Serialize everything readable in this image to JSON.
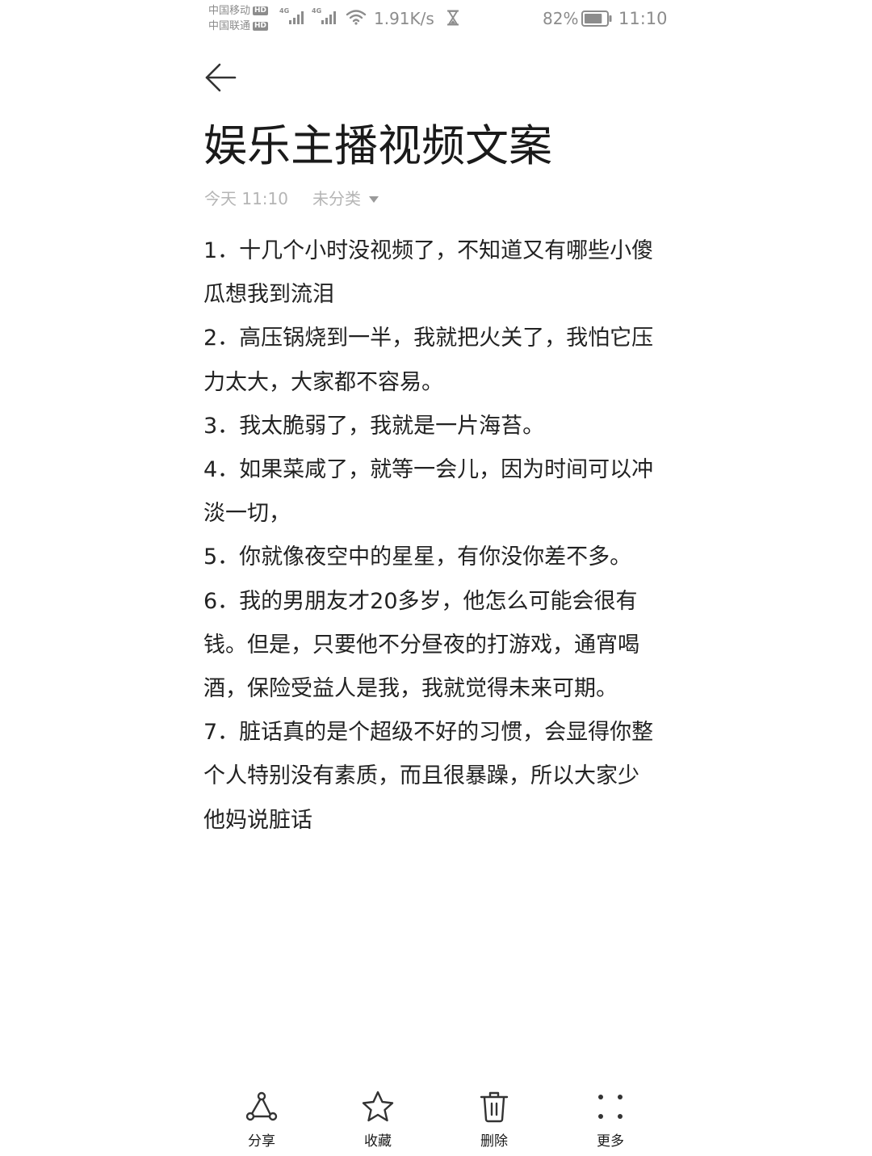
{
  "status_bar": {
    "carrier1": "中国移动",
    "carrier2": "中国联通",
    "hd_badge": "HD",
    "network1": "4G",
    "network2": "4G",
    "net_speed": "1.91K/s",
    "battery": "82%",
    "battery_level": 0.82,
    "time": "11:10"
  },
  "note": {
    "title": "娱乐主播视频文案",
    "date": "今天 11:10",
    "category": "未分类",
    "items": [
      "1．十几个小时没视频了，不知道又有哪些小傻瓜想我到流泪",
      "2．高压锅烧到一半，我就把火关了，我怕它压力太大，大家都不容易。",
      "3．我太脆弱了，我就是一片海苔。",
      "4．如果菜咸了，就等一会儿，因为时间可以冲淡一切，",
      "5．你就像夜空中的星星，有你没你差不多。",
      "6．我的男朋友才20多岁，他怎么可能会很有钱。但是，只要他不分昼夜的打游戏，通宵喝酒，保险受益人是我，我就觉得未来可期。",
      "7．脏话真的是个超级不好的习惯，会显得你整个人特别没有素质，而且很暴躁，所以大家少他妈说脏话"
    ]
  },
  "toolbar": {
    "share_label": "分享",
    "favorite_label": "收藏",
    "delete_label": "删除",
    "more_label": "更多"
  },
  "icons": {
    "back": "arrow-left-icon",
    "share": "share-nodes-icon",
    "favorite": "star-icon",
    "delete": "trash-icon",
    "more": "four-dots-icon"
  },
  "colors": {
    "text": "#1a1a1a",
    "muted": "#b5b5b5",
    "status": "#8c8c8c",
    "background": "#ffffff"
  }
}
